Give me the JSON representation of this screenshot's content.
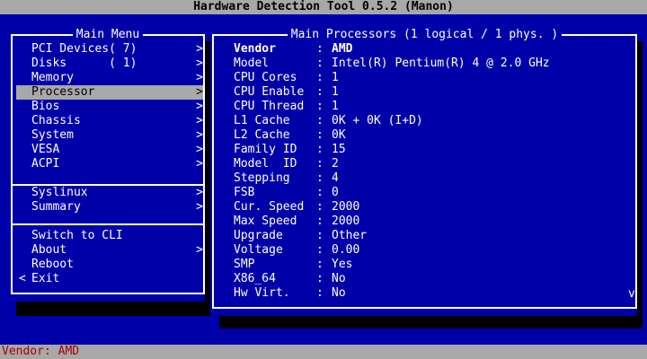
{
  "title": "Hardware Detection Tool 0.5.2 (Manon)",
  "status": "Vendor: AMD",
  "menu": {
    "title": "Main Menu",
    "arrow": ">",
    "exit_arrow": "<",
    "items": [
      {
        "label": "PCI Devices( 7)",
        "arrow": ">",
        "selected": false
      },
      {
        "label": "Disks      ( 1)",
        "arrow": ">",
        "selected": false
      },
      {
        "label": "Memory",
        "arrow": ">",
        "selected": false
      },
      {
        "label": "Processor",
        "arrow": ">",
        "selected": true
      },
      {
        "label": "Bios",
        "arrow": ">",
        "selected": false
      },
      {
        "label": "Chassis",
        "arrow": ">",
        "selected": false
      },
      {
        "label": "System",
        "arrow": ">",
        "selected": false
      },
      {
        "label": "VESA",
        "arrow": ">",
        "selected": false
      },
      {
        "label": "ACPI",
        "arrow": ">",
        "selected": false
      }
    ],
    "group2": [
      {
        "label": "Syslinux",
        "arrow": ">"
      },
      {
        "label": "Summary",
        "arrow": ">"
      }
    ],
    "group3": [
      {
        "label": "Switch to CLI",
        "arrow": ""
      },
      {
        "label": "About",
        "arrow": ">"
      },
      {
        "label": "Reboot",
        "arrow": ""
      },
      {
        "label": "Exit",
        "arrow": ""
      }
    ]
  },
  "processor": {
    "title": "Main Processors (1 logical / 1 phys. )",
    "separator": ":",
    "rows": [
      {
        "key": "Vendor",
        "value": "AMD"
      },
      {
        "key": "Model",
        "value": "Intel(R) Pentium(R) 4 @ 2.0 GHz"
      },
      {
        "key": "CPU Cores",
        "value": "1"
      },
      {
        "key": "CPU Enable",
        "value": "1"
      },
      {
        "key": "CPU Thread",
        "value": "1"
      },
      {
        "key": "L1 Cache",
        "value": "0K + 0K (I+D)"
      },
      {
        "key": "L2 Cache",
        "value": "0K"
      },
      {
        "key": "Family ID",
        "value": "15"
      },
      {
        "key": "Model  ID",
        "value": "2"
      },
      {
        "key": "Stepping",
        "value": "4"
      },
      {
        "key": "FSB",
        "value": "0"
      },
      {
        "key": "Cur. Speed",
        "value": "2000"
      },
      {
        "key": "Max Speed",
        "value": "2000"
      },
      {
        "key": "Upgrade",
        "value": "Other"
      },
      {
        "key": "Voltage",
        "value": "0.00"
      },
      {
        "key": "SMP",
        "value": "Yes"
      },
      {
        "key": "X86_64",
        "value": "No"
      },
      {
        "key": "Hw Virt.",
        "value": "No"
      }
    ],
    "scroll_indicator": "v"
  },
  "colors": {
    "background": "#0000a8",
    "bar": "#a8a8a8",
    "status_text": "#a80000",
    "text": "#ffffff",
    "shadow": "#000000"
  }
}
